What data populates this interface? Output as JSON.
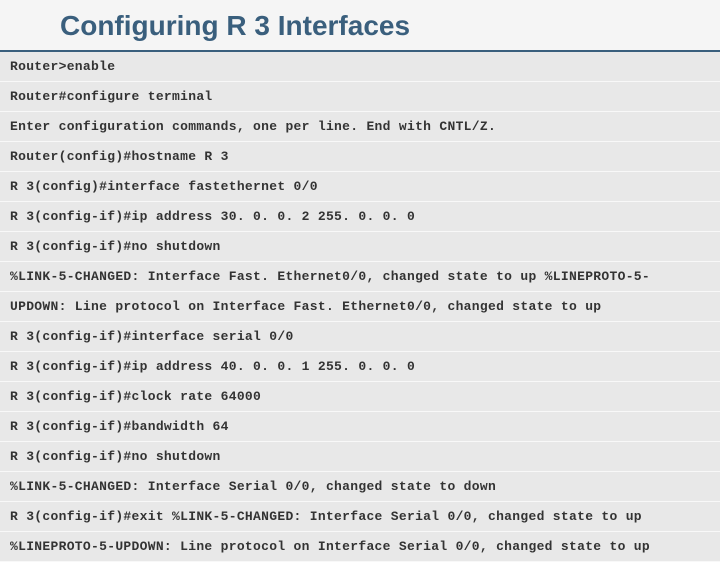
{
  "title": "Configuring R 3 Interfaces",
  "lines": [
    "Router>enable",
    "Router#configure terminal",
    "Enter configuration commands, one per line. End with CNTL/Z.",
    "Router(config)#hostname R 3",
    "R 3(config)#interface fastethernet 0/0",
    "R 3(config-if)#ip address 30. 0. 0. 2 255. 0. 0. 0",
    "R 3(config-if)#no shutdown",
    "%LINK-5-CHANGED: Interface Fast. Ethernet0/0, changed state to up %LINEPROTO-5-",
    "UPDOWN: Line protocol on Interface Fast. Ethernet0/0, changed state to up",
    "R 3(config-if)#interface serial 0/0",
    "R 3(config-if)#ip address 40. 0. 0. 1 255. 0. 0. 0",
    "R 3(config-if)#clock rate 64000",
    "R 3(config-if)#bandwidth 64",
    "R 3(config-if)#no shutdown",
    "%LINK-5-CHANGED: Interface Serial 0/0, changed state to down",
    "R 3(config-if)#exit %LINK-5-CHANGED: Interface Serial 0/0, changed state to up",
    "%LINEPROTO-5-UPDOWN: Line protocol on Interface Serial 0/0, changed state to up"
  ]
}
